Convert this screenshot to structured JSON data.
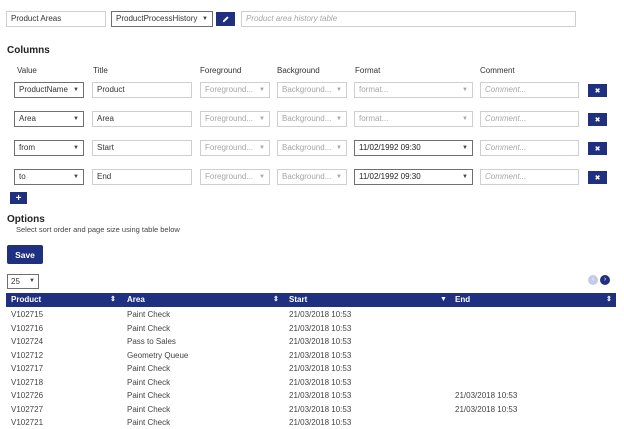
{
  "header": {
    "name": "Product Areas",
    "table": "ProductProcessHistory",
    "description_placeholder": "Product area history table"
  },
  "columns_section": {
    "title": "Columns",
    "headers": {
      "value": "Value",
      "title": "Title",
      "foreground": "Foreground",
      "background": "Background",
      "format": "Format",
      "comment": "Comment"
    },
    "rows": [
      {
        "value": "ProductName",
        "title": "Product",
        "foreground": "Foreground...",
        "background": "Background...",
        "format": "format...",
        "format_set": false,
        "comment": "Comment..."
      },
      {
        "value": "Area",
        "title": "Area",
        "foreground": "Foreground...",
        "background": "Background...",
        "format": "format...",
        "format_set": false,
        "comment": "Comment..."
      },
      {
        "value": "from",
        "title": "Start",
        "foreground": "Foreground...",
        "background": "Background...",
        "format": "11/02/1992 09:30",
        "format_set": true,
        "comment": "Comment..."
      },
      {
        "value": "to",
        "title": "End",
        "foreground": "Foreground...",
        "background": "Background...",
        "format": "11/02/1992 09:30",
        "format_set": true,
        "comment": "Comment..."
      }
    ],
    "add_label": "+",
    "remove_label": "✖"
  },
  "options": {
    "title": "Options",
    "hint": "Select sort order and page size using table below"
  },
  "save_label": "Save",
  "page_size": "25",
  "table": {
    "headers": [
      "Product",
      "Area",
      "Start",
      "End"
    ],
    "sort_icons": [
      "⇕",
      "⇕",
      "▼",
      "⇕"
    ],
    "rows": [
      [
        "V102715",
        "Paint Check",
        "21/03/2018 10:53",
        ""
      ],
      [
        "V102716",
        "Paint Check",
        "21/03/2018 10:53",
        ""
      ],
      [
        "V102724",
        "Pass to Sales",
        "21/03/2018 10:53",
        ""
      ],
      [
        "V102712",
        "Geometry Queue",
        "21/03/2018 10:53",
        ""
      ],
      [
        "V102717",
        "Paint Check",
        "21/03/2018 10:53",
        ""
      ],
      [
        "V102718",
        "Paint Check",
        "21/03/2018 10:53",
        ""
      ],
      [
        "V102726",
        "Paint Check",
        "21/03/2018 10:53",
        "21/03/2018 10:53"
      ],
      [
        "V102727",
        "Paint Check",
        "21/03/2018 10:53",
        "21/03/2018 10:53"
      ],
      [
        "V102721",
        "Paint Check",
        "21/03/2018 10:53",
        ""
      ]
    ]
  },
  "colors": {
    "primary": "#203081",
    "border": "#cfcfcf",
    "muted_text": "#a6a6a6"
  }
}
